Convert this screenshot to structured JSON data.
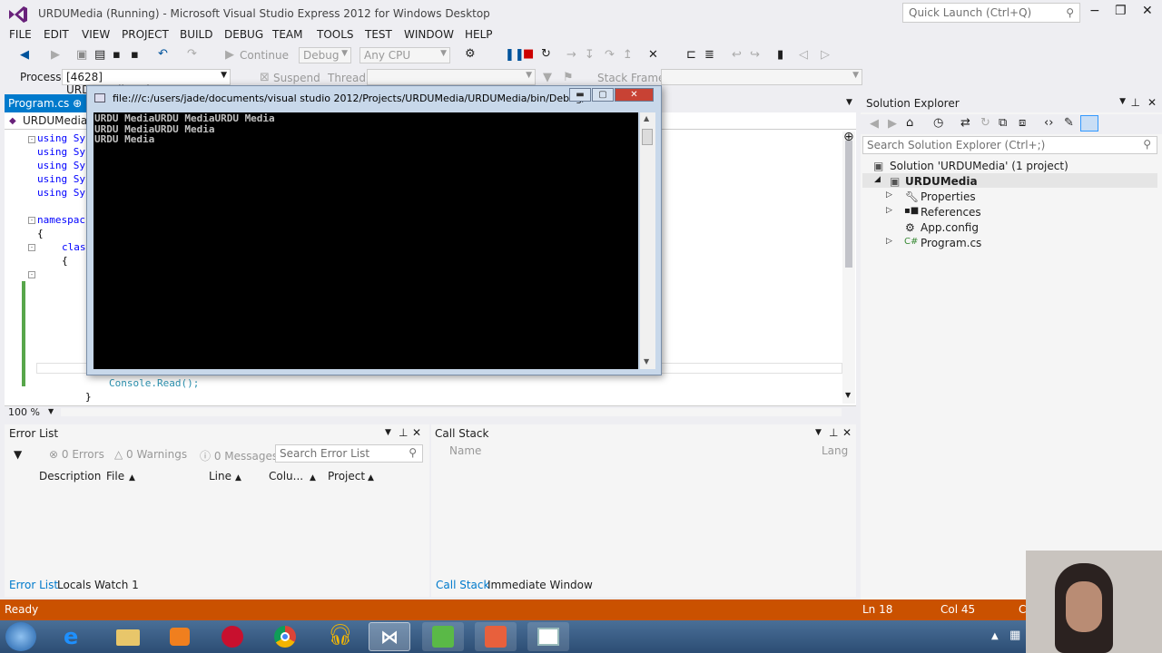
{
  "window": {
    "title": "URDUMedia (Running) - Microsoft Visual Studio Express 2012 for Windows Desktop",
    "quick_launch_placeholder": "Quick Launch (Ctrl+Q)",
    "minimize": "−",
    "restore": "❐",
    "close": "✕"
  },
  "menu": [
    "FILE",
    "EDIT",
    "VIEW",
    "PROJECT",
    "BUILD",
    "DEBUG",
    "TEAM",
    "TOOLS",
    "TEST",
    "WINDOW",
    "HELP"
  ],
  "toolbar": {
    "continue_label": "Continue",
    "config": "Debug",
    "platform": "Any CPU",
    "process_label": "Process:",
    "process_value": "[4628] URDUMedia.vshost.exe",
    "suspend_label": "Suspend",
    "thread_label": "Thread:",
    "stack_frame_label": "Stack Frame:"
  },
  "editor": {
    "tab_label": "Program.cs",
    "tab_pin": "⊕",
    "nav_label": "URDUMedia.P",
    "lines": {
      "u1": "using Sy",
      "u2": "using Sy",
      "u3": "using Sy",
      "u4": "using Sy",
      "u5": "using Sy",
      "ns": "namespac",
      "brace1": "{",
      "cls": "clas",
      "brace2": "{",
      "console_read": "Console.Read();",
      "brace3": "}"
    },
    "zoom": "100 %"
  },
  "console": {
    "title": "file:///c:/users/jade/documents/visual studio 2012/Projects/URDUMedia/URDUMedia/bin/Debug/...",
    "output": "URDU MediaURDU MediaURDU Media\nURDU MediaURDU Media\nURDU Media"
  },
  "solution_explorer": {
    "title": "Solution Explorer",
    "search_placeholder": "Search Solution Explorer (Ctrl+;)",
    "solution": "Solution 'URDUMedia' (1 project)",
    "project": "URDUMedia",
    "items": [
      "Properties",
      "References",
      "App.config",
      "Program.cs"
    ]
  },
  "error_list": {
    "title": "Error List",
    "errors": "0 Errors",
    "warnings": "0 Warnings",
    "messages": "0 Messages",
    "search_placeholder": "Search Error List",
    "columns": [
      "Description",
      "File",
      "Line",
      "Colu...",
      "Project"
    ]
  },
  "call_stack": {
    "title": "Call Stack",
    "columns": [
      "Name",
      "Lang"
    ]
  },
  "bottom_tabs_left": [
    "Error List",
    "Locals",
    "Watch 1"
  ],
  "bottom_tabs_right": [
    "Call Stack",
    "Immediate Window"
  ],
  "status": {
    "ready": "Ready",
    "ln": "Ln 18",
    "col": "Col 45",
    "ch": "C"
  },
  "colors": {
    "accent": "#007acc",
    "status_bar": "#ca5100",
    "taskbar": "#2c4d74"
  }
}
